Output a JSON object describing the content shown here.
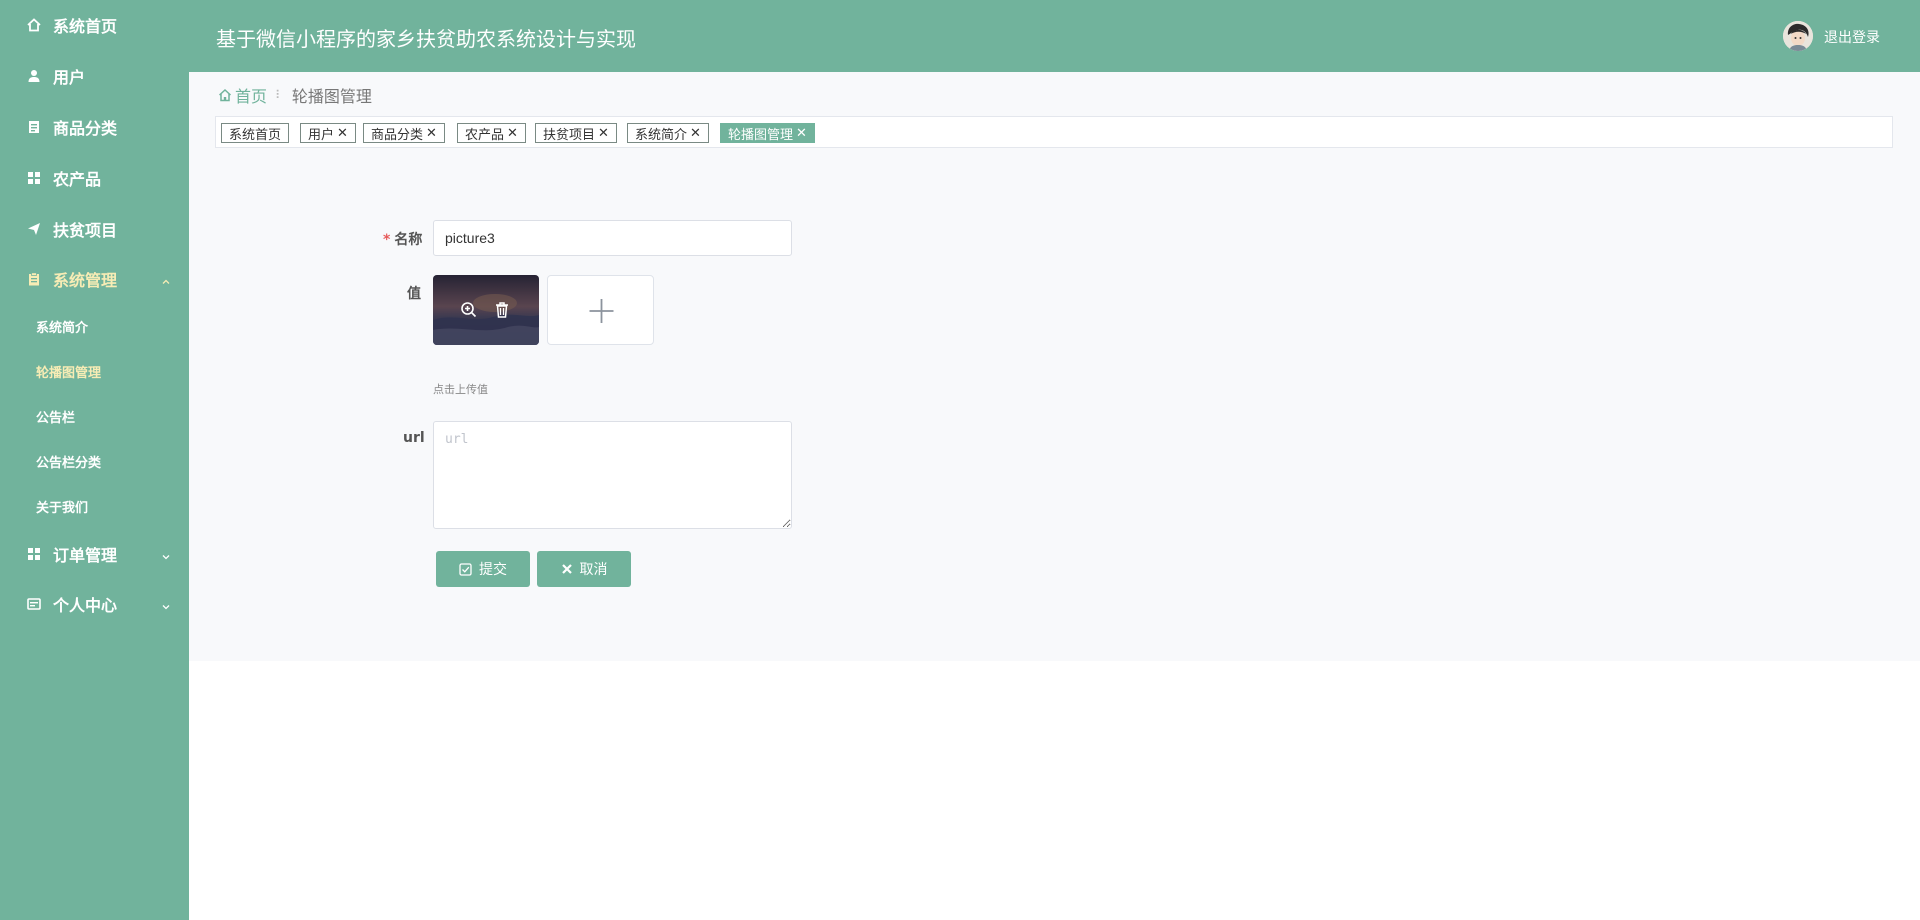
{
  "colors": {
    "primary": "#71b39c",
    "active_text": "#f7ecb5",
    "required": "#e65a5a"
  },
  "header": {
    "title": "基于微信小程序的家乡扶贫助农系统设计与实现",
    "logout": "退出登录"
  },
  "sidebar": {
    "items": [
      {
        "label": "系统首页",
        "icon": "home-icon"
      },
      {
        "label": "用户",
        "icon": "user-icon"
      },
      {
        "label": "商品分类",
        "icon": "document-icon"
      },
      {
        "label": "农产品",
        "icon": "grid-icon"
      },
      {
        "label": "扶贫项目",
        "icon": "send-icon"
      },
      {
        "label": "系统管理",
        "icon": "clipboard-icon",
        "expanded": true
      },
      {
        "label": "订单管理",
        "icon": "grid-icon"
      },
      {
        "label": "个人中心",
        "icon": "id-card-icon"
      }
    ],
    "sub_items": [
      "系统简介",
      "轮播图管理",
      "公告栏",
      "公告栏分类",
      "关于我们"
    ]
  },
  "breadcrumb": {
    "home": "首页",
    "current": "轮播图管理"
  },
  "tags": [
    {
      "label": "系统首页",
      "closable": false
    },
    {
      "label": "用户",
      "closable": true
    },
    {
      "label": "商品分类",
      "closable": true
    },
    {
      "label": "农产品",
      "closable": true
    },
    {
      "label": "扶贫项目",
      "closable": true
    },
    {
      "label": "系统简介",
      "closable": true
    },
    {
      "label": "轮播图管理",
      "closable": true,
      "active": true
    }
  ],
  "form": {
    "name_label": "名称",
    "name_value": "picture3",
    "value_label": "值",
    "upload_hint": "点击上传值",
    "url_label": "url",
    "url_placeholder": "url",
    "submit_label": "提交",
    "cancel_label": "取消"
  }
}
